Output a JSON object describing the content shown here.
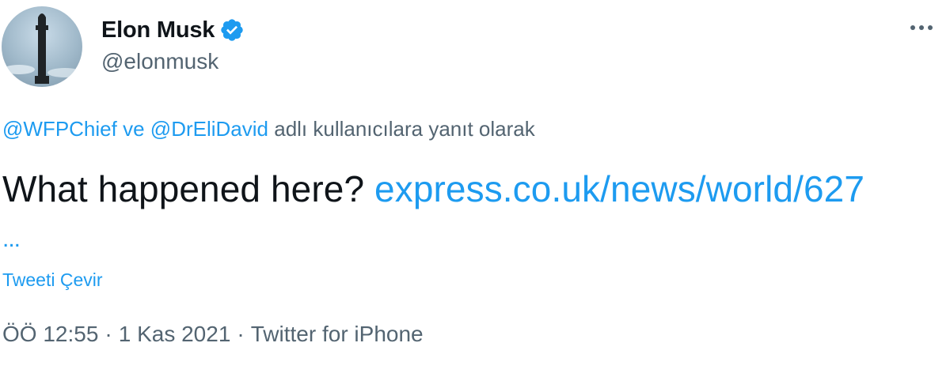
{
  "author": {
    "display_name": "Elon Musk",
    "handle": "@elonmusk",
    "verified": true
  },
  "reply_context": {
    "user1": "@WFPChief",
    "conj": "ve",
    "user2": "@DrEliDavid",
    "suffix": "adlı kullanıcılara yanıt olarak"
  },
  "tweet": {
    "text": "What happened here?",
    "link": "express.co.uk/news/world/627",
    "truncation": "..."
  },
  "translate_label": "Tweeti Çevir",
  "meta": {
    "time": "ÖÖ 12:55",
    "date": "1 Kas 2021",
    "source": "Twitter for iPhone",
    "separator": "·"
  },
  "icons": {
    "more": "more-options-icon",
    "verified": "verified-badge-icon"
  },
  "colors": {
    "link": "#1d9bf0",
    "secondary_text": "#536471",
    "primary_text": "#0f1419"
  }
}
